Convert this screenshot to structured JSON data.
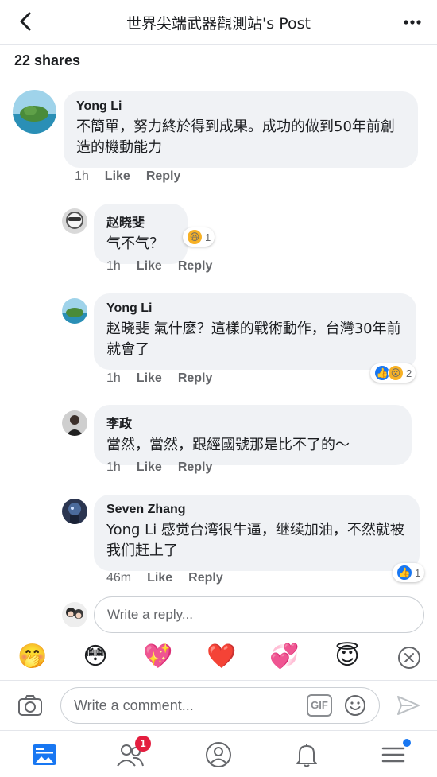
{
  "header": {
    "title": "世界尖端武器觀測站's Post",
    "back_icon": "chevron-left-icon",
    "more_icon": "ellipsis-icon"
  },
  "shares_label": "22 shares",
  "comments": [
    {
      "author": "Yong Li",
      "text": "不簡單，努力終於得到成果。成功的做到50年前創造的機動能力",
      "time": "1h",
      "like": "Like",
      "reply": "Reply"
    },
    {
      "author": "赵晓斐",
      "text": "气不气？",
      "time": "1h",
      "like": "Like",
      "reply": "Reply",
      "reactions": {
        "icons": [
          "laugh"
        ],
        "count": "1"
      }
    },
    {
      "author": "Yong Li",
      "text": "赵晓斐 氣什麼？這樣的戰術動作，台灣30年前就會了",
      "time": "1h",
      "like": "Like",
      "reply": "Reply",
      "reactions": {
        "icons": [
          "like",
          "wow"
        ],
        "count": "2"
      }
    },
    {
      "author": "李政",
      "text": "當然，當然，跟經國號那是比不了的～",
      "time": "1h",
      "like": "Like",
      "reply": "Reply"
    },
    {
      "author": "Seven Zhang",
      "text": "Yong Li 感觉台湾很牛逼，继续加油，不然就被我们赶上了",
      "time": "46m",
      "like": "Like",
      "reply": "Reply",
      "reactions": {
        "icons": [
          "like"
        ],
        "count": "1"
      }
    }
  ],
  "reply_box": {
    "placeholder": "Write a reply..."
  },
  "emoji_bar": [
    "🤭",
    "😳",
    "💖",
    "❤️",
    "💞",
    "😇"
  ],
  "composer": {
    "placeholder": "Write a comment...",
    "gif_label": "GIF"
  },
  "tabbar": {
    "friend_badge": "1"
  },
  "colors": {
    "accent": "#1877f2",
    "bubble": "#f0f2f5",
    "badge": "#e41e3f"
  }
}
